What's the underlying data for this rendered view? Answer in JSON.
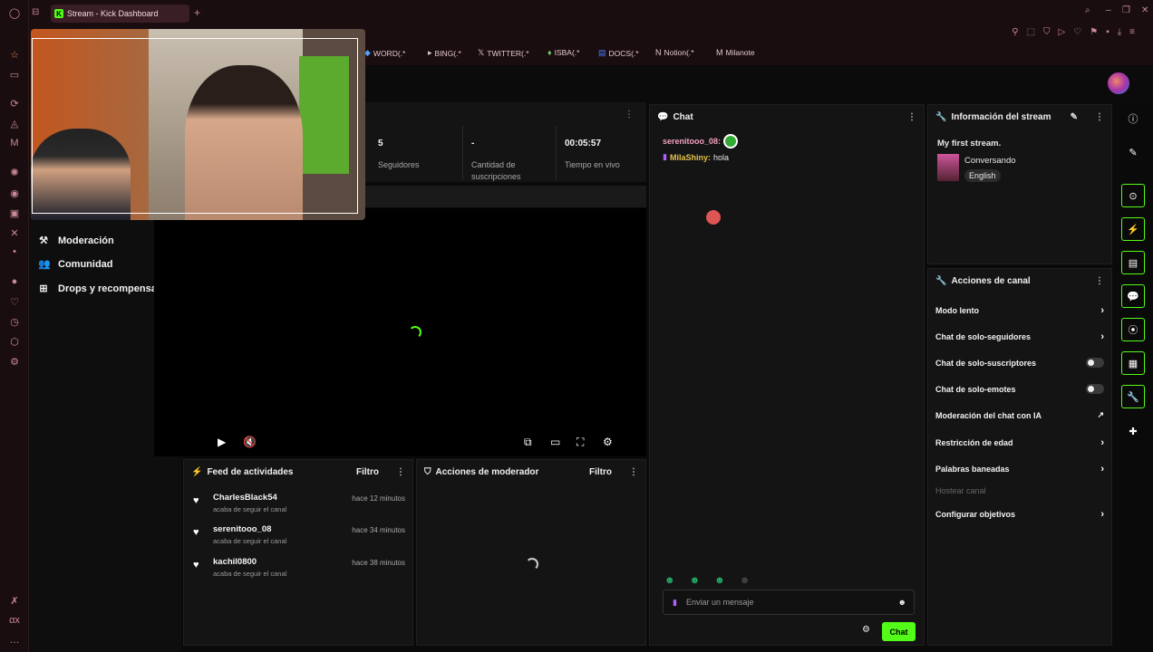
{
  "browser": {
    "tab_title": "Stream - Kick Dashboard",
    "bookmarks": [
      "WORD(.*",
      "BING(.*",
      "TWITTER(.*",
      "ISBA(.*",
      "DOCS(.*",
      "Notion(.*",
      "Milanote"
    ]
  },
  "nav": {
    "moderacion": "Moderación",
    "comunidad": "Comunidad",
    "drops": "Drops y recompensas"
  },
  "stats": {
    "followers_value": "5",
    "followers_label": "Seguidores",
    "subs_value": "-",
    "subs_label": "Cantidad de suscripciones",
    "time_value": "00:05:57",
    "time_label": "Tiempo en vivo"
  },
  "feed": {
    "title": "Feed de actividades",
    "filter": "Filtro",
    "items": [
      {
        "name": "CharlesBlack54",
        "sub": "acaba de seguir el canal",
        "time": "hace 12 minutos"
      },
      {
        "name": "serenitooo_08",
        "sub": "acaba de seguir el canal",
        "time": "hace 34 minutos"
      },
      {
        "name": "kachil0800",
        "sub": "acaba de seguir el canal",
        "time": "hace 38 minutos"
      }
    ]
  },
  "modactions": {
    "title": "Acciones de moderador",
    "filter": "Filtro"
  },
  "chat": {
    "title": "Chat",
    "messages": [
      {
        "user": "serenitooo_08:",
        "text": "",
        "color": "#f0a0c0"
      },
      {
        "user": "MilaShiny:",
        "text": "hola",
        "color": "#e6c24a"
      }
    ],
    "placeholder": "Enviar un mensaje",
    "send": "Chat"
  },
  "info": {
    "title": "Información del stream",
    "stream_title": "My first stream.",
    "category": "Conversando",
    "language": "English"
  },
  "channel_actions": {
    "title": "Acciones de canal",
    "items": [
      {
        "label": "Modo lento",
        "kind": "chevron"
      },
      {
        "label": "Chat de solo-seguidores",
        "kind": "chevron"
      },
      {
        "label": "Chat de solo-suscriptores",
        "kind": "toggle"
      },
      {
        "label": "Chat de solo-emotes",
        "kind": "toggle"
      },
      {
        "label": "Moderación del chat con IA",
        "kind": "external"
      },
      {
        "label": "Restricción de edad",
        "kind": "chevron"
      },
      {
        "label": "Palabras baneadas",
        "kind": "chevron"
      },
      {
        "label": "Hostear canal",
        "kind": "disabled"
      },
      {
        "label": "Configurar objetivos",
        "kind": "chevron"
      }
    ]
  },
  "colors": {
    "accent": "#53fc18",
    "panel": "#141414",
    "browser": "#1a0d10"
  }
}
